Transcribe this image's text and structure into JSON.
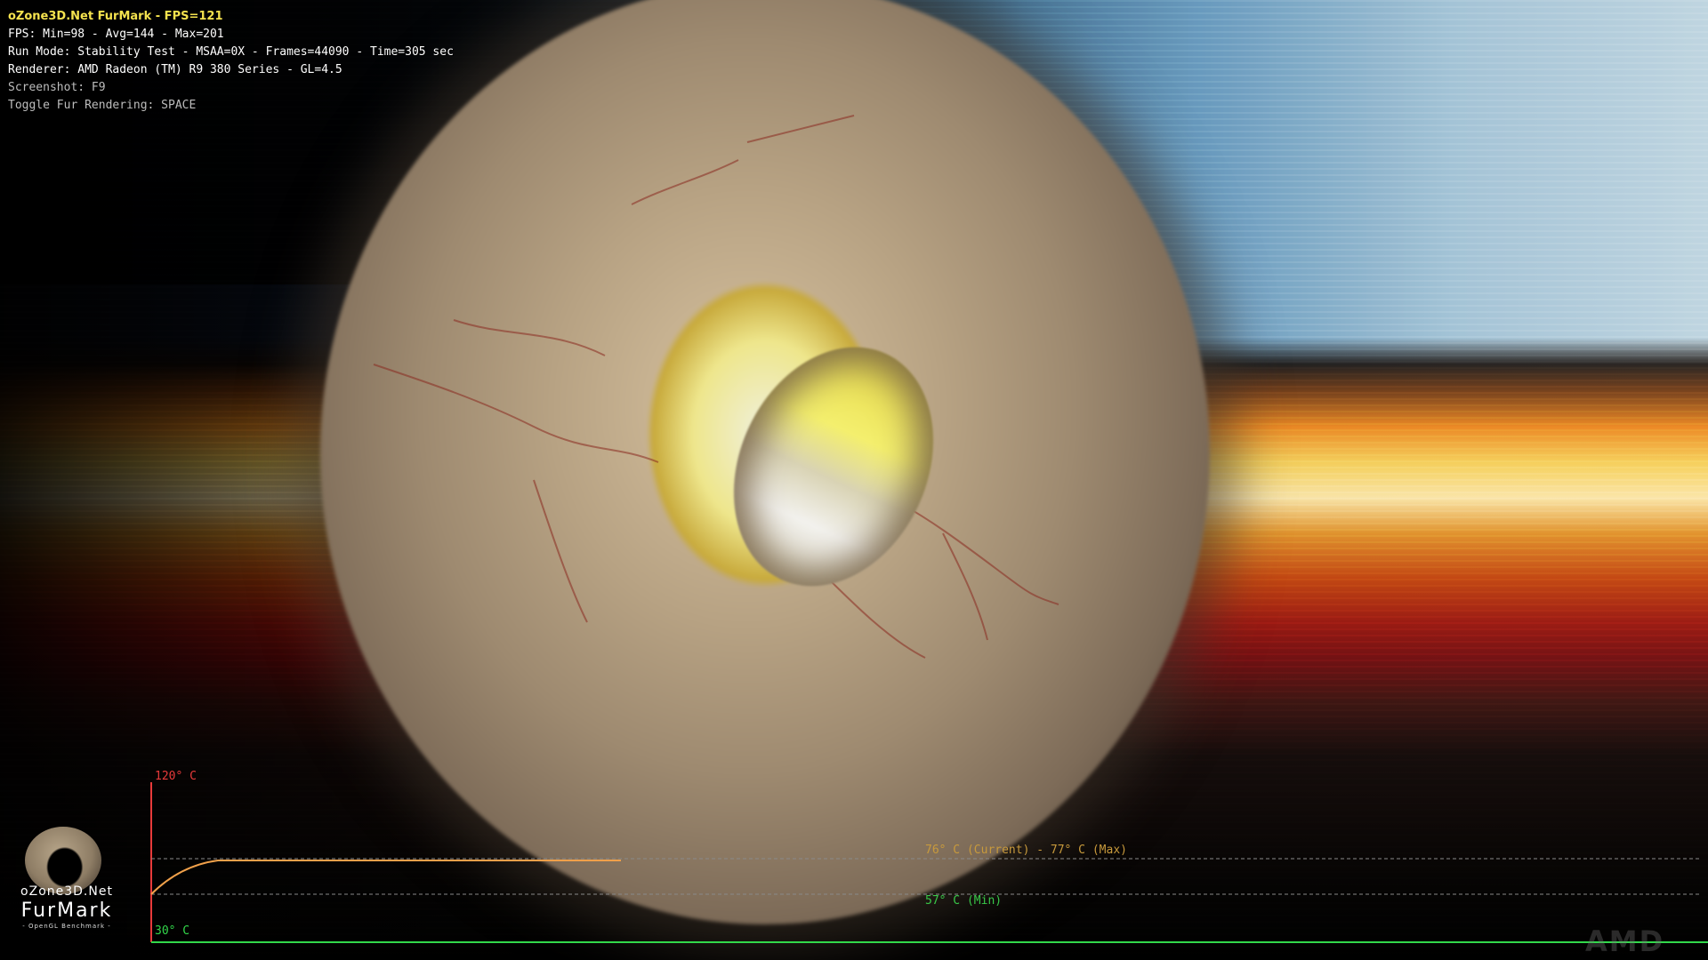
{
  "hud": {
    "title": "oZone3D.Net FurMark - FPS=121",
    "fps_line": "FPS: Min=98 - Avg=144 - Max=201",
    "run_mode": "Run Mode: Stability Test - MSAA=0X - Frames=44090 - Time=305 sec",
    "renderer": "Renderer: AMD Radeon (TM) R9 380 Series - GL=4.5",
    "screenshot": "Screenshot: F9",
    "toggle": "Toggle Fur Rendering: SPACE"
  },
  "temperature_graph": {
    "max_axis_label": "120° C",
    "min_axis_label": "30° C",
    "current_max_label": "76° C (Current) - 77° C (Max)",
    "min_label": "57° C (Min)",
    "current_c": 76,
    "max_c": 77,
    "min_c": 57,
    "axis_min_c": 30,
    "axis_max_c": 120,
    "colors": {
      "axis_vertical": "#e83a3a",
      "axis_horizontal": "#32d84a",
      "curve": "#f0a04a",
      "guide": "#8a8a8a"
    }
  },
  "logo": {
    "line1": "oZone3D.Net",
    "line2": "FurMark",
    "line3": "- OpenGL Benchmark -"
  },
  "watermark": "AMD"
}
